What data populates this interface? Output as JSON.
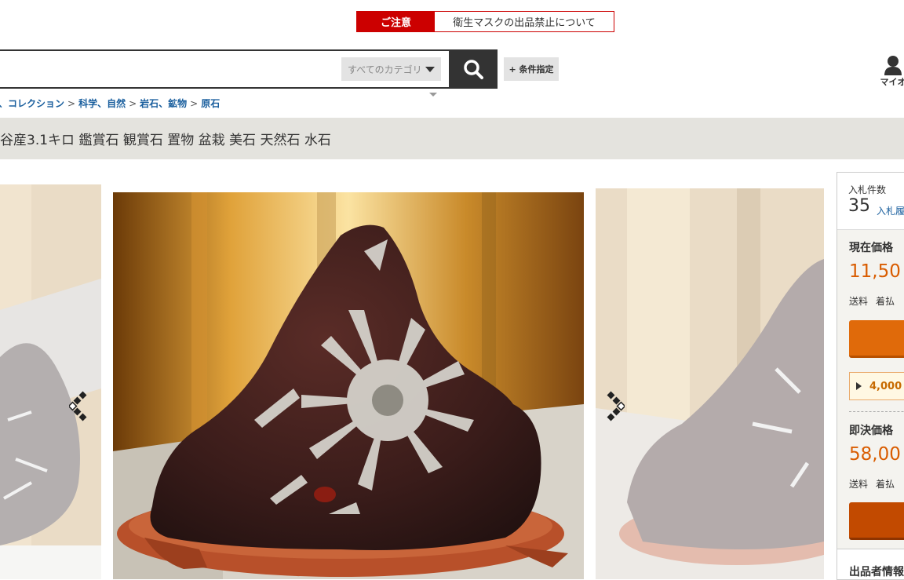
{
  "notice": {
    "tag": "ご注意",
    "message": "衛生マスクの出品禁止について"
  },
  "search": {
    "category_label": "すべてのカテゴリ",
    "condition_button": "+ 条件指定"
  },
  "header": {
    "myauction_label": "マイオ"
  },
  "breadcrumb": {
    "items": [
      "、コレクション",
      "科学、自然",
      "岩石、鉱物",
      "原石"
    ],
    "separator": ">"
  },
  "item": {
    "title": "谷産3.1キロ 鑑賞石 観賞石 置物 盆栽 美石 天然石 水石"
  },
  "panel": {
    "bids_label": "入札件数",
    "bids_count": "35",
    "bids_link": "入札履",
    "current_label": "現在価格",
    "current_price": "11,50",
    "shipping_label": "送料",
    "shipping_value": "着払",
    "sub_price": "4,000",
    "buyout_label": "即決価格",
    "buyout_price": "58,00",
    "seller_label": "出品者情報"
  },
  "colors": {
    "accent": "#d95c00",
    "bid_button": "#e06a0a",
    "buyout_button": "#c24a00",
    "notice_red": "#cc0000"
  },
  "icons": [
    "search-icon",
    "user-icon",
    "prev-arrow-icon",
    "next-arrow-icon"
  ]
}
